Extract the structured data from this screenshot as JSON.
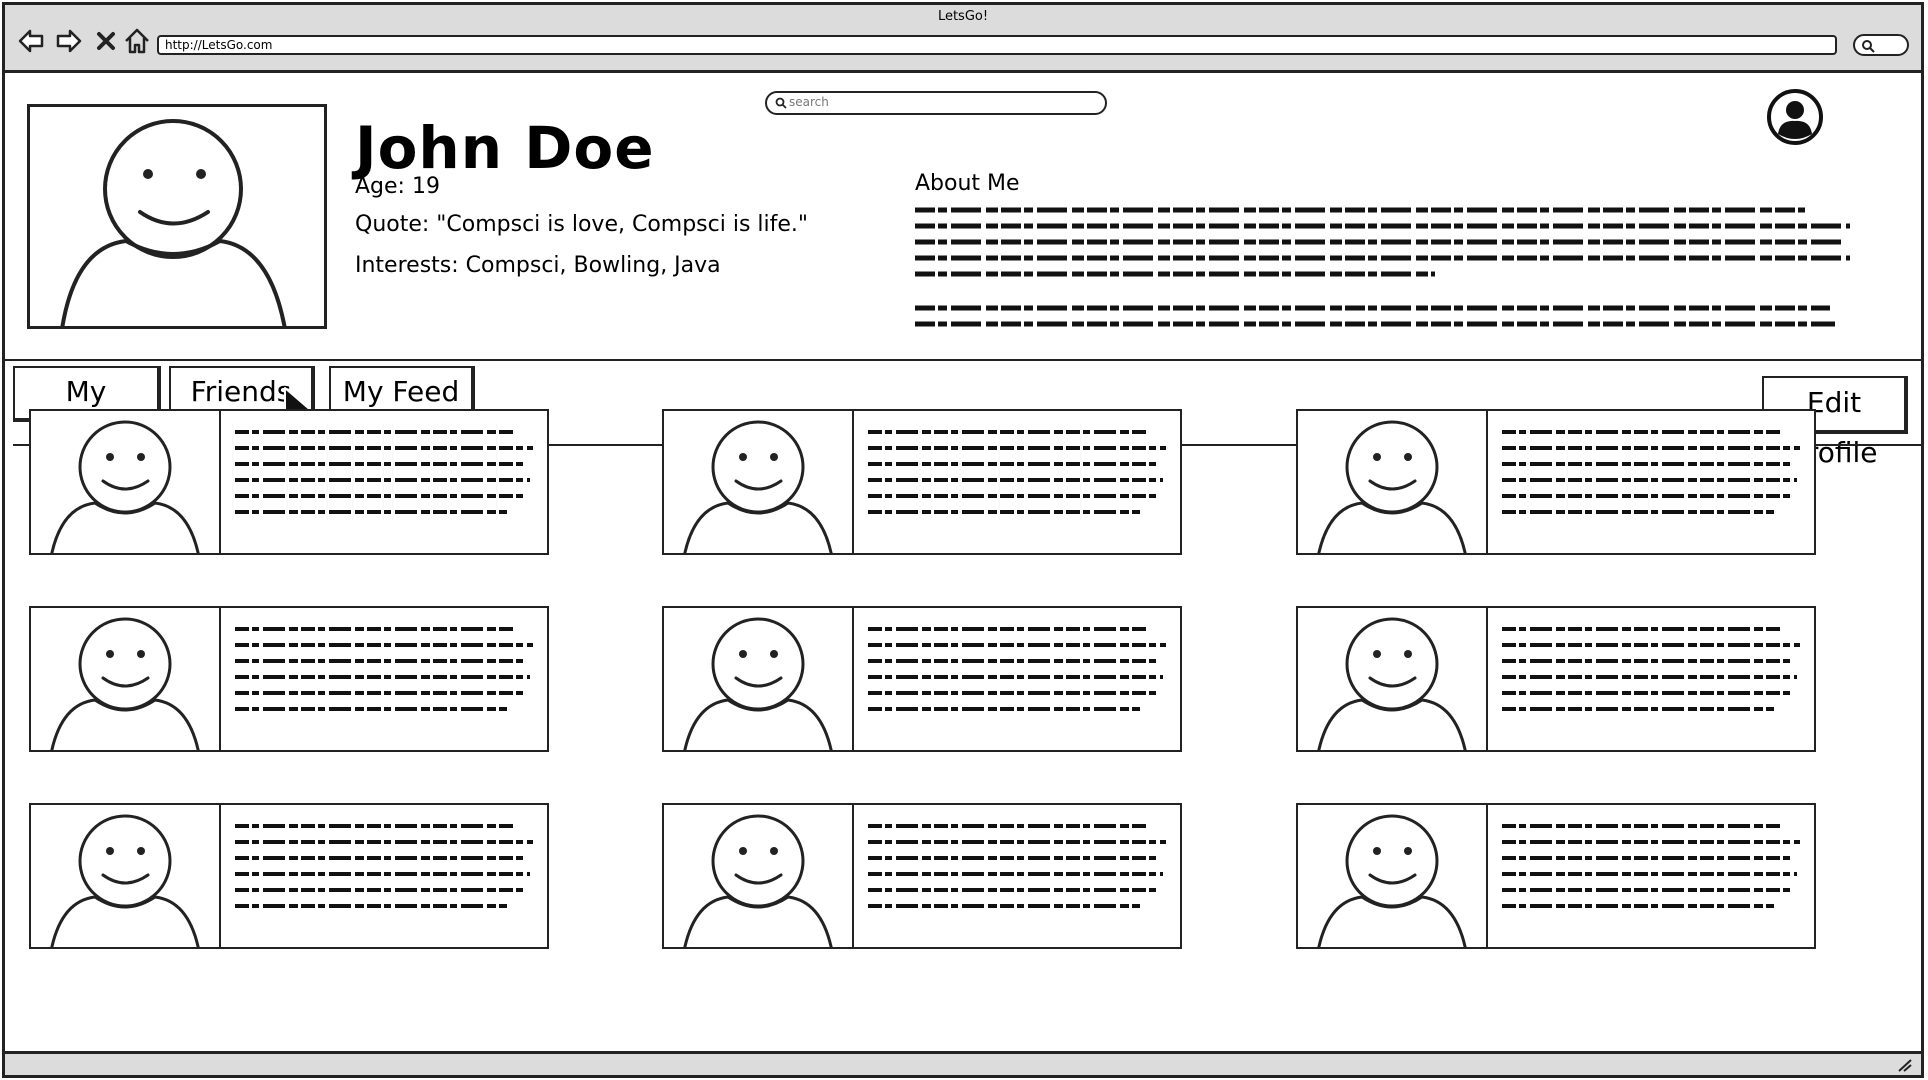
{
  "browser": {
    "window_title": "LetsGo!",
    "url": "http://LetsGo.com"
  },
  "header": {
    "search_placeholder": "search"
  },
  "profile": {
    "name": "John Doe",
    "age": "Age: 19",
    "quote": "Quote: \"Compsci is love, Compsci is life.\"",
    "interests": "Interests: Compsci, Bowling, Java",
    "about_title": "About Me"
  },
  "tabs": [
    {
      "label": "My Events"
    },
    {
      "label": "Friends"
    },
    {
      "label": "My Feed"
    }
  ],
  "edit_profile_label": "Edit Profile",
  "friend_cards_count": 9,
  "icons": {
    "back": "arrow-left-icon",
    "forward": "arrow-right-icon",
    "stop": "close-icon",
    "home": "home-icon",
    "search": "search-icon",
    "user": "user-avatar-icon",
    "cursor": "mouse-pointer-icon"
  }
}
